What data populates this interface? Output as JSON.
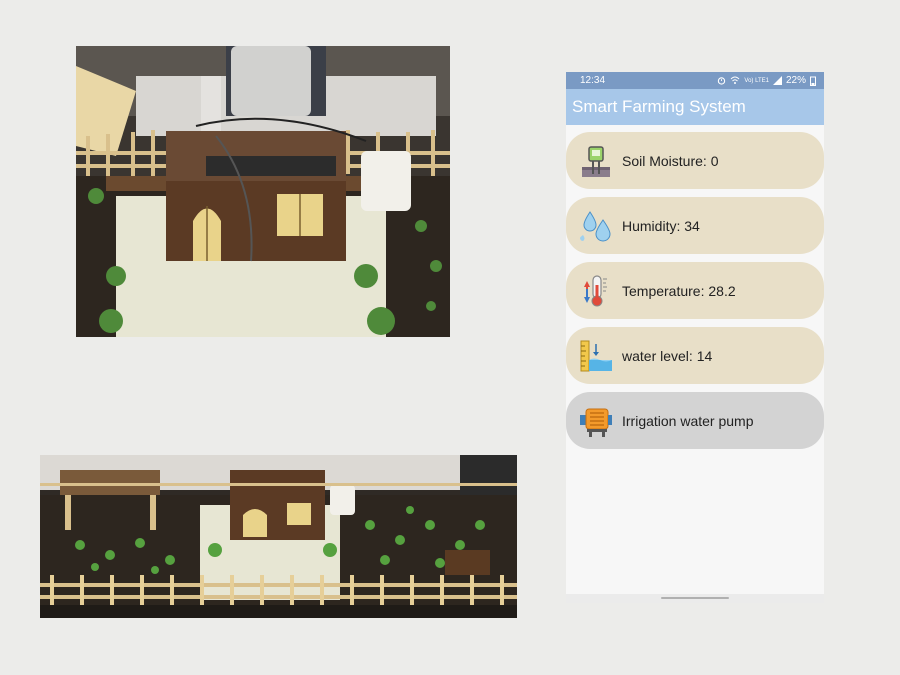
{
  "status_bar": {
    "time": "12:34",
    "network": "Vo) LTE1",
    "battery": "22%"
  },
  "app": {
    "title": "Smart Farming System"
  },
  "cards": [
    {
      "label": "Soil Moisture: 0",
      "icon": "soil-moisture-sensor-icon",
      "bg": "#e8dfc8"
    },
    {
      "label": "Humidity: 34",
      "icon": "water-drops-icon",
      "bg": "#e8dfc8"
    },
    {
      "label": "Temperature: 28.2",
      "icon": "thermometer-icon",
      "bg": "#e8dfc8"
    },
    {
      "label": "water level: 14",
      "icon": "water-level-icon",
      "bg": "#e8dfc8"
    },
    {
      "label": "Irrigation water pump",
      "icon": "water-pump-icon",
      "bg": "#d3d3d3"
    }
  ],
  "photos": [
    {
      "name": "farm-model-house-photo"
    },
    {
      "name": "farm-model-overview-photo"
    }
  ]
}
